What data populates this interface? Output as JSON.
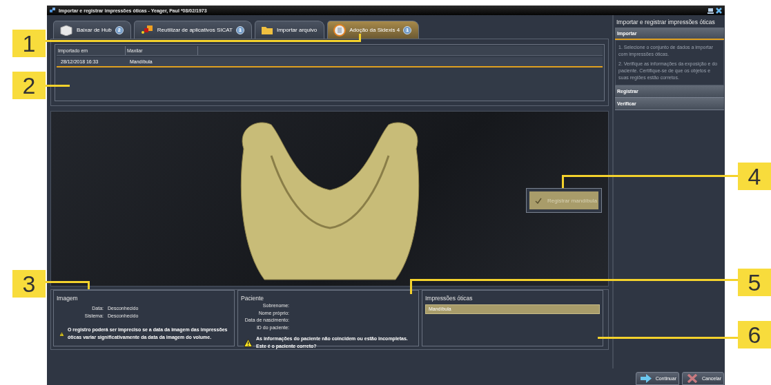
{
  "window": {
    "title": "Importar e registrar impressões óticas - Yeager, Paul *08/02/1973"
  },
  "tabs": [
    {
      "label": "Baixar de Hub",
      "badge": "2",
      "kind": "hub",
      "selected": false
    },
    {
      "label": "Reutilizar de aplicativos SICAT",
      "badge": "1",
      "kind": "apps",
      "selected": false
    },
    {
      "label": "Importar arquivo",
      "kind": "folder",
      "selected": false
    },
    {
      "label": "Adoção da Sidexis 4",
      "badge": "1",
      "kind": "sidexis",
      "selected": true
    }
  ],
  "table": {
    "columns": [
      "Importado em",
      "Maxilar"
    ],
    "rows": [
      {
        "cells": [
          "28/12/2018 16:33",
          "Mandíbula"
        ],
        "selected": true
      }
    ]
  },
  "viewer": {
    "register_button": {
      "label": "Registrar mandíbula",
      "disabled": true
    }
  },
  "image_panel": {
    "title": "Imagem",
    "fields": [
      {
        "label": "Data:",
        "value": "Desconhecido"
      },
      {
        "label": "Sistema:",
        "value": "Desconhecido"
      }
    ],
    "warning": "O registro poderá ser impreciso se a data da imagem das impressões óticas variar significativamente da data da imagem do volume."
  },
  "patient_panel": {
    "title": "Paciente",
    "fields": [
      {
        "label": "Sobrenome:"
      },
      {
        "label": "Nome próprio:"
      },
      {
        "label": "Data de nascimento:"
      },
      {
        "label": "ID do paciente:"
      }
    ],
    "warning": "As informações do paciente não coincidem ou estão incompletas.\nEste é o paciente correto?"
  },
  "impressions_panel": {
    "title": "Impressões óticas",
    "items": [
      {
        "label": "Mandíbula",
        "selected": true
      }
    ]
  },
  "sidebar": {
    "title": "Importar e registrar impressões óticas",
    "steps": [
      {
        "label": "Importar",
        "expanded": true,
        "paragraphs": [
          "1. Selecione o conjunto de dados a importar com impressões óticas.",
          "2. Verifique as informações da exposição e do paciente. Certifique-se de que os objetos e suas regiões estão corretos."
        ]
      },
      {
        "label": "Registrar",
        "expanded": false
      },
      {
        "label": "Verificar",
        "expanded": false
      }
    ]
  },
  "buttons": [
    {
      "label": "Continuar",
      "kind": "continue"
    },
    {
      "label": "Cancelar",
      "kind": "cancel"
    }
  ],
  "callouts": [
    "1",
    "2",
    "3",
    "4",
    "5",
    "6"
  ]
}
